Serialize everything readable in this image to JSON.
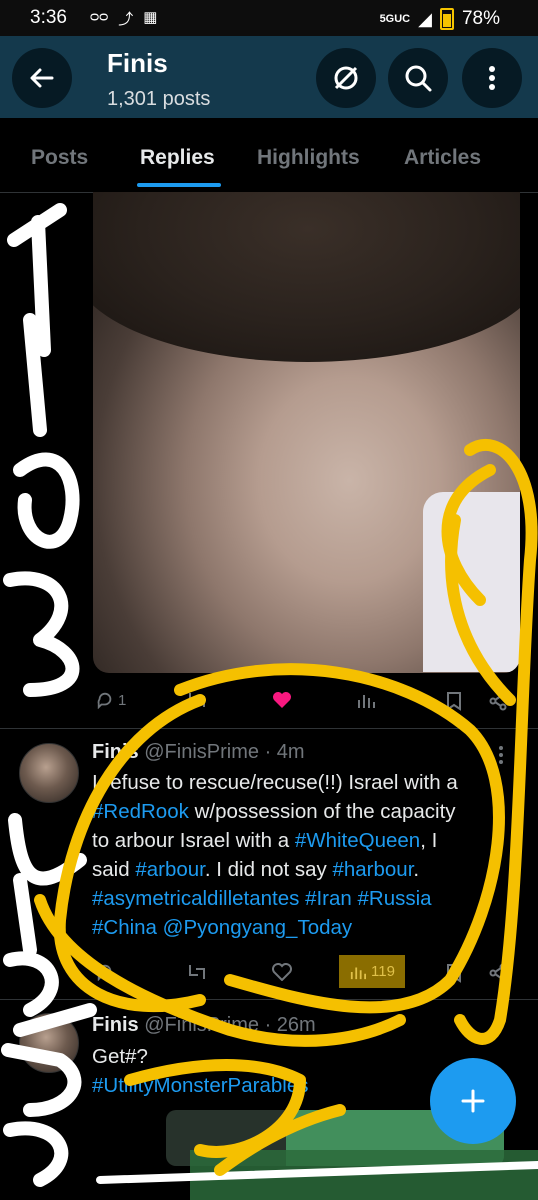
{
  "status_bar": {
    "time": "3:36",
    "network": "5GUC",
    "battery": "78%"
  },
  "header": {
    "title": "Finis",
    "post_count": "1,301 posts"
  },
  "tabs": [
    "Posts",
    "Replies",
    "Highlights",
    "Articles"
  ],
  "active_tab": "Replies",
  "post1": {
    "replies": "1"
  },
  "post2": {
    "name": "Finis",
    "handle": "@FinisPrime",
    "time": "· 4m",
    "line1": "I refuse to rescue/recuse(!!) Israel with a",
    "line2_tag": "#RedRook",
    "line2_rest": " w/possession of the capacity",
    "line3_pre": "to arbour Israel with a ",
    "line3_tag": "#WhiteQueen",
    "line3_post": ", I",
    "line4_pre": "said ",
    "line4_tag1": "#arbour",
    "line4_mid": ". I did not say ",
    "line4_tag2": "#harbour",
    "line4_end": ".",
    "line5": "#asymetricaldilletantes #Iran #Russia",
    "line6": "#China @Pyongyang_Today",
    "views": "119"
  },
  "post3": {
    "name": "Finis",
    "handle": "@FinisPrime",
    "time": "· 26m",
    "line1": "Get#?",
    "line2": "#UtilityMonsterParables"
  },
  "colors": {
    "accent": "#1d9bf0",
    "header_bg": "#14394c",
    "scribble_yellow": "#f5c000",
    "scribble_white": "#ffffff"
  }
}
